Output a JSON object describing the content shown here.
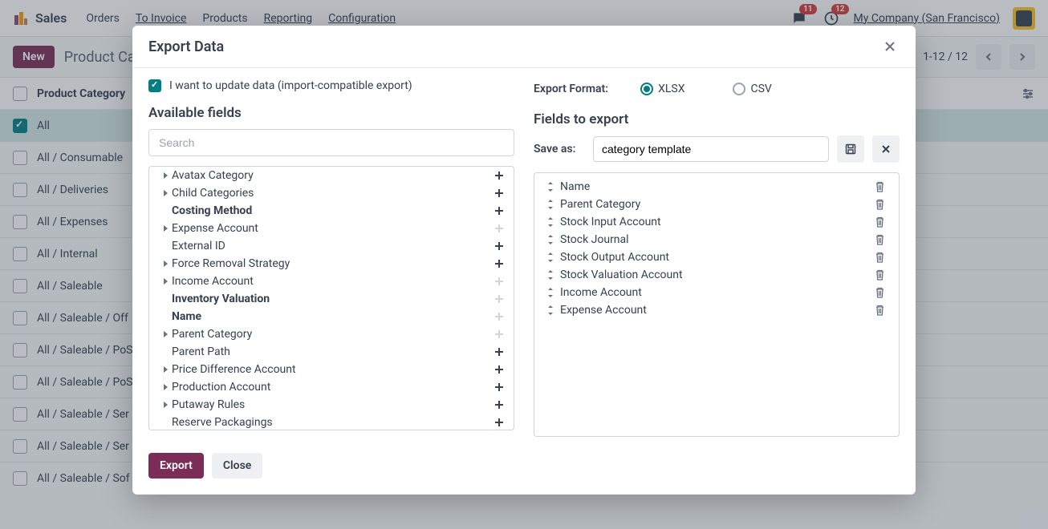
{
  "navbar": {
    "app_name": "Sales",
    "links": [
      "Orders",
      "To Invoice",
      "Products",
      "Reporting",
      "Configuration"
    ],
    "chat_badge": "11",
    "activity_badge": "12",
    "company": "My Company (San Francisco)"
  },
  "action_bar": {
    "new_label": "New",
    "breadcrumb": "Product Cat",
    "pager_text": "1-12 / 12"
  },
  "table": {
    "header": "Product Category",
    "rows": [
      {
        "label": "All",
        "checked": true
      },
      {
        "label": "All / Consumable",
        "checked": false
      },
      {
        "label": "All / Deliveries",
        "checked": false
      },
      {
        "label": "All / Expenses",
        "checked": false
      },
      {
        "label": "All / Internal",
        "checked": false
      },
      {
        "label": "All / Saleable",
        "checked": false
      },
      {
        "label": "All / Saleable / Off",
        "checked": false
      },
      {
        "label": "All / Saleable / PoS",
        "checked": false
      },
      {
        "label": "All / Saleable / PoS",
        "checked": false
      },
      {
        "label": "All / Saleable / Ser",
        "checked": false
      },
      {
        "label": "All / Saleable / Ser",
        "checked": false
      },
      {
        "label": "All / Saleable / Sof",
        "checked": false
      }
    ]
  },
  "modal": {
    "title": "Export Data",
    "update_checkbox_label": "I want to update data (import-compatible export)",
    "available_title": "Available fields",
    "search_placeholder": "Search",
    "available_fields": [
      {
        "label": "Avatax Category",
        "expandable": true,
        "addable": true,
        "bold": false
      },
      {
        "label": "Child Categories",
        "expandable": true,
        "addable": true,
        "bold": false
      },
      {
        "label": "Costing Method",
        "expandable": false,
        "addable": true,
        "bold": true
      },
      {
        "label": "Expense Account",
        "expandable": true,
        "addable": false,
        "bold": false
      },
      {
        "label": "External ID",
        "expandable": false,
        "addable": true,
        "bold": false
      },
      {
        "label": "Force Removal Strategy",
        "expandable": true,
        "addable": true,
        "bold": false
      },
      {
        "label": "Income Account",
        "expandable": true,
        "addable": false,
        "bold": false
      },
      {
        "label": "Inventory Valuation",
        "expandable": false,
        "addable": false,
        "bold": true
      },
      {
        "label": "Name",
        "expandable": false,
        "addable": false,
        "bold": true
      },
      {
        "label": "Parent Category",
        "expandable": true,
        "addable": false,
        "bold": false
      },
      {
        "label": "Parent Path",
        "expandable": false,
        "addable": true,
        "bold": false
      },
      {
        "label": "Price Difference Account",
        "expandable": true,
        "addable": true,
        "bold": false
      },
      {
        "label": "Production Account",
        "expandable": true,
        "addable": true,
        "bold": false
      },
      {
        "label": "Putaway Rules",
        "expandable": true,
        "addable": true,
        "bold": false
      },
      {
        "label": "Reserve Packagings",
        "expandable": false,
        "addable": true,
        "bold": false
      }
    ],
    "format_label": "Export Format:",
    "format_options": [
      "XLSX",
      "CSV"
    ],
    "format_selected": "XLSX",
    "fields_to_export_title": "Fields to export",
    "save_as_label": "Save as:",
    "template_name": "category template",
    "export_fields": [
      "Name",
      "Parent Category",
      "Stock Input Account",
      "Stock Journal",
      "Stock Output Account",
      "Stock Valuation Account",
      "Income Account",
      "Expense Account"
    ],
    "export_button": "Export",
    "close_button": "Close"
  }
}
